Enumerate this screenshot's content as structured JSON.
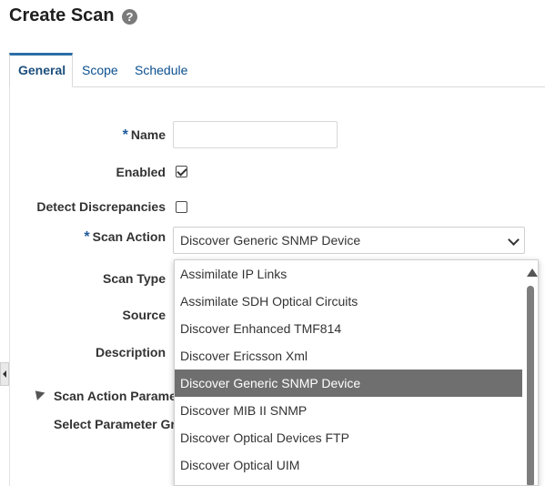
{
  "page": {
    "title": "Create Scan",
    "help_icon": "help-circle-icon"
  },
  "tabs": [
    {
      "label": "General",
      "active": true
    },
    {
      "label": "Scope",
      "active": false
    },
    {
      "label": "Schedule",
      "active": false
    }
  ],
  "form": {
    "name_label": "Name",
    "name_value": "",
    "required_mark": "*",
    "enabled_label": "Enabled",
    "enabled_checked": true,
    "detect_label": "Detect Discrepancies",
    "detect_checked": false,
    "scan_action_label": "Scan Action",
    "scan_action_value": "Discover Generic SNMP Device",
    "scan_type_label": "Scan Type",
    "source_label": "Source",
    "description_label": "Description"
  },
  "section": {
    "title": "Scan Action Paramet",
    "subtitle": "Select Parameter Gro"
  },
  "dropdown": {
    "options": [
      "Assimilate IP Links",
      "Assimilate SDH Optical Circuits",
      "Discover Enhanced TMF814",
      "Discover Ericsson Xml",
      "Discover Generic SNMP Device",
      "Discover MIB II SNMP",
      "Discover Optical Devices FTP",
      "Discover Optical UIM"
    ],
    "selected_index": 4
  }
}
